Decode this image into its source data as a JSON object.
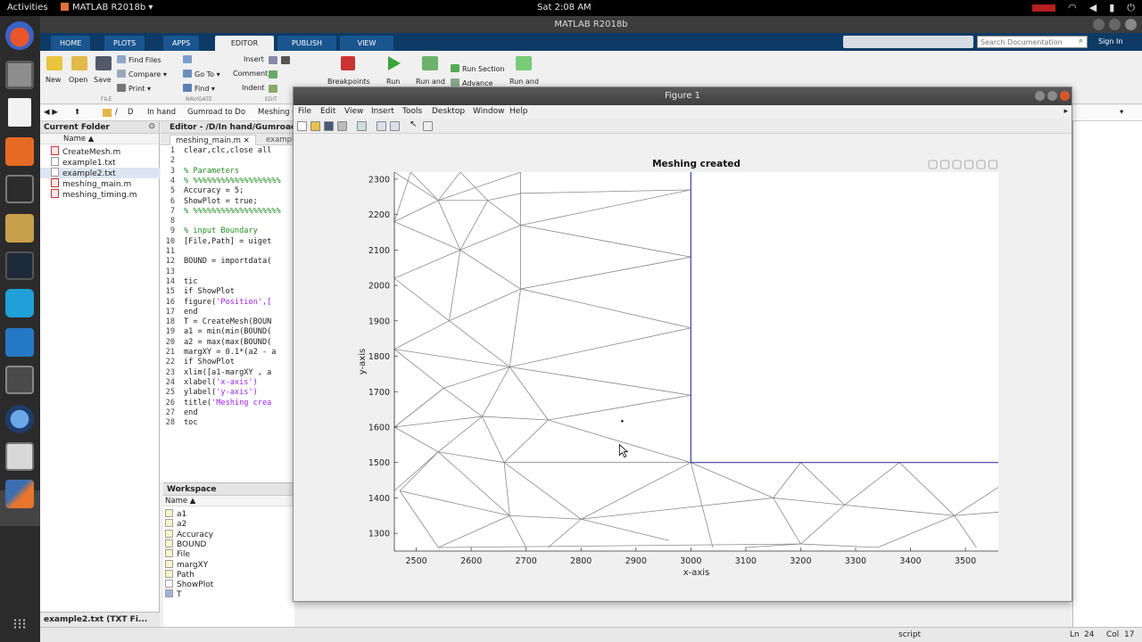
{
  "topbar": {
    "activities": "Activities",
    "app_menu": "MATLAB R2018b ▾",
    "clock": "Sat  2:08 AM"
  },
  "window": {
    "title": "MATLAB R2018b"
  },
  "ribbon": {
    "tabs": [
      "HOME",
      "PLOTS",
      "APPS",
      "EDITOR",
      "PUBLISH",
      "VIEW"
    ],
    "active_tab": "EDITOR",
    "buttons": {
      "new": "New",
      "open": "Open",
      "save": "Save",
      "find_files": "Find Files",
      "compare": "Compare ▾",
      "print": "Print ▾",
      "go_to": "Go To ▾",
      "find": "Find ▾",
      "insert": "Insert",
      "comment": "Comment",
      "indent": "Indent",
      "breakpoints": "Breakpoints",
      "run": "Run",
      "run_and_advance": "Run and",
      "run_section": "Run Section",
      "advance": "Advance",
      "run_and_time": "Run and"
    },
    "groups": {
      "file": "FILE",
      "navigate": "NAVIGATE",
      "edit": "EDIT"
    },
    "search_placeholder": "Search Documentation",
    "sign_in": "Sign In"
  },
  "address": {
    "crumbs": [
      "/",
      "D",
      "In hand",
      "Gumroad to Do",
      "Meshing c"
    ]
  },
  "current_folder": {
    "title": "Current Folder",
    "column": "Name ▲",
    "files": [
      {
        "name": "CreateMesh.m",
        "type": "m"
      },
      {
        "name": "example1.txt",
        "type": "txt"
      },
      {
        "name": "example2.txt",
        "type": "txt"
      },
      {
        "name": "meshing_main.m",
        "type": "m"
      },
      {
        "name": "meshing_timing.m",
        "type": "m"
      }
    ],
    "details": "example2.txt  (TXT Fi..."
  },
  "editor": {
    "title": "Editor - /D/In hand/Gumroad",
    "tabs": [
      "meshing_main.m",
      "exampl"
    ],
    "lines": [
      {
        "n": "1",
        "code": "clear,clc,close all"
      },
      {
        "n": "2",
        "code": ""
      },
      {
        "n": "3",
        "code": "% Parameters",
        "cls": "cm"
      },
      {
        "n": "4",
        "code": "% %%%%%%%%%%%%%%%%%%%",
        "cls": "cm"
      },
      {
        "n": "5",
        "code": "Accuracy = 5;"
      },
      {
        "n": "6",
        "code": "ShowPlot = true;"
      },
      {
        "n": "7",
        "code": "% %%%%%%%%%%%%%%%%%%%",
        "cls": "cm"
      },
      {
        "n": "8",
        "code": ""
      },
      {
        "n": "9",
        "code": "% input Boundary",
        "cls": "cm"
      },
      {
        "n": "10",
        "code": "[File,Path] = uiget"
      },
      {
        "n": "11",
        "code": ""
      },
      {
        "n": "12",
        "code": "BOUND = importdata("
      },
      {
        "n": "13",
        "code": ""
      },
      {
        "n": "14",
        "code": "tic"
      },
      {
        "n": "15",
        "code": "if ShowPlot"
      },
      {
        "n": "16",
        "code": "figure('Position',[",
        "has_str": true
      },
      {
        "n": "17",
        "code": "end"
      },
      {
        "n": "18",
        "code": "T = CreateMesh(BOUN"
      },
      {
        "n": "19",
        "code": "a1 = min(min(BOUND("
      },
      {
        "n": "20",
        "code": "a2 = max(max(BOUND("
      },
      {
        "n": "21",
        "code": "margXY = 0.1*(a2 - a"
      },
      {
        "n": "22",
        "code": "if ShowPlot"
      },
      {
        "n": "23",
        "code": "xlim([a1-margXY , a"
      },
      {
        "n": "24",
        "code": "xlabel('x-axis')",
        "has_str": true
      },
      {
        "n": "25",
        "code": "ylabel('y-axis')",
        "has_str": true
      },
      {
        "n": "26",
        "code": "title('Meshing crea",
        "has_str": true
      },
      {
        "n": "27",
        "code": "end"
      },
      {
        "n": "28",
        "code": "toc"
      }
    ]
  },
  "workspace": {
    "title": "Workspace",
    "column": "Name ▲",
    "vars": [
      "a1",
      "a2",
      "Accuracy",
      "BOUND",
      "File",
      "margXY",
      "Path",
      "ShowPlot",
      "T"
    ]
  },
  "status": {
    "mode": "script",
    "ln_label": "Ln",
    "ln": "24",
    "col_label": "Col",
    "col": "17"
  },
  "figure": {
    "title": "Figure 1",
    "menu": [
      "File",
      "Edit",
      "View",
      "Insert",
      "Tools",
      "Desktop",
      "Window",
      "Help"
    ]
  },
  "chart_data": {
    "type": "mesh",
    "title": "Meshing created",
    "xlabel": "x-axis",
    "ylabel": "y-axis",
    "xlim": [
      2460,
      3560
    ],
    "ylim": [
      1250,
      2320
    ],
    "xticks": [
      2500,
      2600,
      2700,
      2800,
      2900,
      3000,
      3100,
      3200,
      3300,
      3400,
      3500
    ],
    "yticks": [
      1300,
      1400,
      1500,
      1600,
      1700,
      1800,
      1900,
      2000,
      2100,
      2200,
      2300
    ],
    "boundary_color": "#3d3dab",
    "mesh_color": "#8a8a8a",
    "boundary": [
      [
        3000,
        2320
      ],
      [
        3000,
        1500
      ],
      [
        3560,
        1500
      ]
    ],
    "edges": [
      [
        [
          2460,
          2320
        ],
        [
          2540,
          2240
        ]
      ],
      [
        [
          2490,
          2320
        ],
        [
          2460,
          2180
        ]
      ],
      [
        [
          2490,
          2320
        ],
        [
          2540,
          2240
        ]
      ],
      [
        [
          2540,
          2240
        ],
        [
          2580,
          2320
        ]
      ],
      [
        [
          2540,
          2240
        ],
        [
          2690,
          2320
        ]
      ],
      [
        [
          2540,
          2240
        ],
        [
          2630,
          2240
        ]
      ],
      [
        [
          2630,
          2240
        ],
        [
          2690,
          2260
        ]
      ],
      [
        [
          2690,
          2260
        ],
        [
          2690,
          2320
        ]
      ],
      [
        [
          2690,
          2260
        ],
        [
          3000,
          2270
        ]
      ],
      [
        [
          2630,
          2240
        ],
        [
          2580,
          2320
        ]
      ],
      [
        [
          2460,
          2180
        ],
        [
          2540,
          2240
        ]
      ],
      [
        [
          2460,
          2180
        ],
        [
          2580,
          2100
        ]
      ],
      [
        [
          2540,
          2240
        ],
        [
          2580,
          2100
        ]
      ],
      [
        [
          2630,
          2240
        ],
        [
          2580,
          2100
        ]
      ],
      [
        [
          2630,
          2240
        ],
        [
          2690,
          2170
        ]
      ],
      [
        [
          2690,
          2170
        ],
        [
          2690,
          2260
        ]
      ],
      [
        [
          2690,
          2170
        ],
        [
          3000,
          2270
        ]
      ],
      [
        [
          2690,
          2170
        ],
        [
          3000,
          2080
        ]
      ],
      [
        [
          2580,
          2100
        ],
        [
          2690,
          2170
        ]
      ],
      [
        [
          2460,
          2180
        ],
        [
          2460,
          2020
        ]
      ],
      [
        [
          2460,
          2020
        ],
        [
          2580,
          2100
        ]
      ],
      [
        [
          2580,
          2100
        ],
        [
          2690,
          1990
        ]
      ],
      [
        [
          2690,
          2170
        ],
        [
          2690,
          1990
        ]
      ],
      [
        [
          2690,
          1990
        ],
        [
          3000,
          2080
        ]
      ],
      [
        [
          2690,
          1990
        ],
        [
          3000,
          1880
        ]
      ],
      [
        [
          2460,
          2020
        ],
        [
          2560,
          1900
        ]
      ],
      [
        [
          2580,
          2100
        ],
        [
          2560,
          1900
        ]
      ],
      [
        [
          2560,
          1900
        ],
        [
          2690,
          1990
        ]
      ],
      [
        [
          2460,
          1820
        ],
        [
          2560,
          1900
        ]
      ],
      [
        [
          2460,
          2020
        ],
        [
          2460,
          1820
        ]
      ],
      [
        [
          2560,
          1900
        ],
        [
          2670,
          1770
        ]
      ],
      [
        [
          2690,
          1990
        ],
        [
          2670,
          1770
        ]
      ],
      [
        [
          2670,
          1770
        ],
        [
          3000,
          1880
        ]
      ],
      [
        [
          2670,
          1770
        ],
        [
          3000,
          1690
        ]
      ],
      [
        [
          2460,
          1820
        ],
        [
          2670,
          1770
        ]
      ],
      [
        [
          2460,
          1820
        ],
        [
          2550,
          1710
        ]
      ],
      [
        [
          2550,
          1710
        ],
        [
          2670,
          1770
        ]
      ],
      [
        [
          2460,
          1600
        ],
        [
          2550,
          1710
        ]
      ],
      [
        [
          2460,
          1820
        ],
        [
          2460,
          1600
        ]
      ],
      [
        [
          2550,
          1710
        ],
        [
          2620,
          1630
        ]
      ],
      [
        [
          2670,
          1770
        ],
        [
          2620,
          1630
        ]
      ],
      [
        [
          2670,
          1770
        ],
        [
          2740,
          1620
        ]
      ],
      [
        [
          2620,
          1630
        ],
        [
          2740,
          1620
        ]
      ],
      [
        [
          2740,
          1620
        ],
        [
          3000,
          1690
        ]
      ],
      [
        [
          2740,
          1620
        ],
        [
          3000,
          1500
        ]
      ],
      [
        [
          2550,
          1710
        ],
        [
          2460,
          1600
        ]
      ],
      [
        [
          2460,
          1600
        ],
        [
          2620,
          1630
        ]
      ],
      [
        [
          2460,
          1600
        ],
        [
          2540,
          1530
        ]
      ],
      [
        [
          2540,
          1530
        ],
        [
          2620,
          1630
        ]
      ],
      [
        [
          2620,
          1630
        ],
        [
          2660,
          1500
        ]
      ],
      [
        [
          2740,
          1620
        ],
        [
          2660,
          1500
        ]
      ],
      [
        [
          2540,
          1530
        ],
        [
          2660,
          1500
        ]
      ],
      [
        [
          2660,
          1500
        ],
        [
          3000,
          1500
        ]
      ],
      [
        [
          2540,
          1530
        ],
        [
          2460,
          1420
        ]
      ],
      [
        [
          2460,
          1600
        ],
        [
          2460,
          1420
        ]
      ],
      [
        [
          2540,
          1530
        ],
        [
          2470,
          1420
        ]
      ],
      [
        [
          2470,
          1420
        ],
        [
          2670,
          1350
        ]
      ],
      [
        [
          2540,
          1530
        ],
        [
          2670,
          1350
        ]
      ],
      [
        [
          2660,
          1500
        ],
        [
          2670,
          1350
        ]
      ],
      [
        [
          2660,
          1500
        ],
        [
          2800,
          1340
        ]
      ],
      [
        [
          3000,
          1500
        ],
        [
          2800,
          1340
        ]
      ],
      [
        [
          2670,
          1350
        ],
        [
          2800,
          1340
        ]
      ],
      [
        [
          2470,
          1420
        ],
        [
          2540,
          1260
        ]
      ],
      [
        [
          2670,
          1350
        ],
        [
          2540,
          1260
        ]
      ],
      [
        [
          2670,
          1350
        ],
        [
          2700,
          1260
        ]
      ],
      [
        [
          2800,
          1340
        ],
        [
          2740,
          1260
        ]
      ],
      [
        [
          2800,
          1340
        ],
        [
          2960,
          1280
        ]
      ],
      [
        [
          3000,
          1500
        ],
        [
          3040,
          1260
        ]
      ],
      [
        [
          3000,
          1500
        ],
        [
          3150,
          1400
        ]
      ],
      [
        [
          2800,
          1340
        ],
        [
          3150,
          1400
        ]
      ],
      [
        [
          3150,
          1400
        ],
        [
          3200,
          1500
        ]
      ],
      [
        [
          3200,
          1500
        ],
        [
          3280,
          1380
        ]
      ],
      [
        [
          3150,
          1400
        ],
        [
          3280,
          1380
        ]
      ],
      [
        [
          3280,
          1380
        ],
        [
          3380,
          1500
        ]
      ],
      [
        [
          3380,
          1500
        ],
        [
          3480,
          1350
        ]
      ],
      [
        [
          3280,
          1380
        ],
        [
          3480,
          1350
        ]
      ],
      [
        [
          3480,
          1350
        ],
        [
          3560,
          1430
        ]
      ],
      [
        [
          3480,
          1350
        ],
        [
          3560,
          1360
        ]
      ],
      [
        [
          3150,
          1400
        ],
        [
          3200,
          1270
        ]
      ],
      [
        [
          3280,
          1380
        ],
        [
          3200,
          1270
        ]
      ],
      [
        [
          3200,
          1270
        ],
        [
          3340,
          1260
        ]
      ],
      [
        [
          3480,
          1350
        ],
        [
          3340,
          1260
        ]
      ],
      [
        [
          3480,
          1350
        ],
        [
          3520,
          1260
        ]
      ],
      [
        [
          3200,
          1270
        ],
        [
          3100,
          1260
        ]
      ],
      [
        [
          2540,
          1260
        ],
        [
          3200,
          1270
        ]
      ]
    ],
    "marker": {
      "x": 2875,
      "y": 1617
    }
  }
}
